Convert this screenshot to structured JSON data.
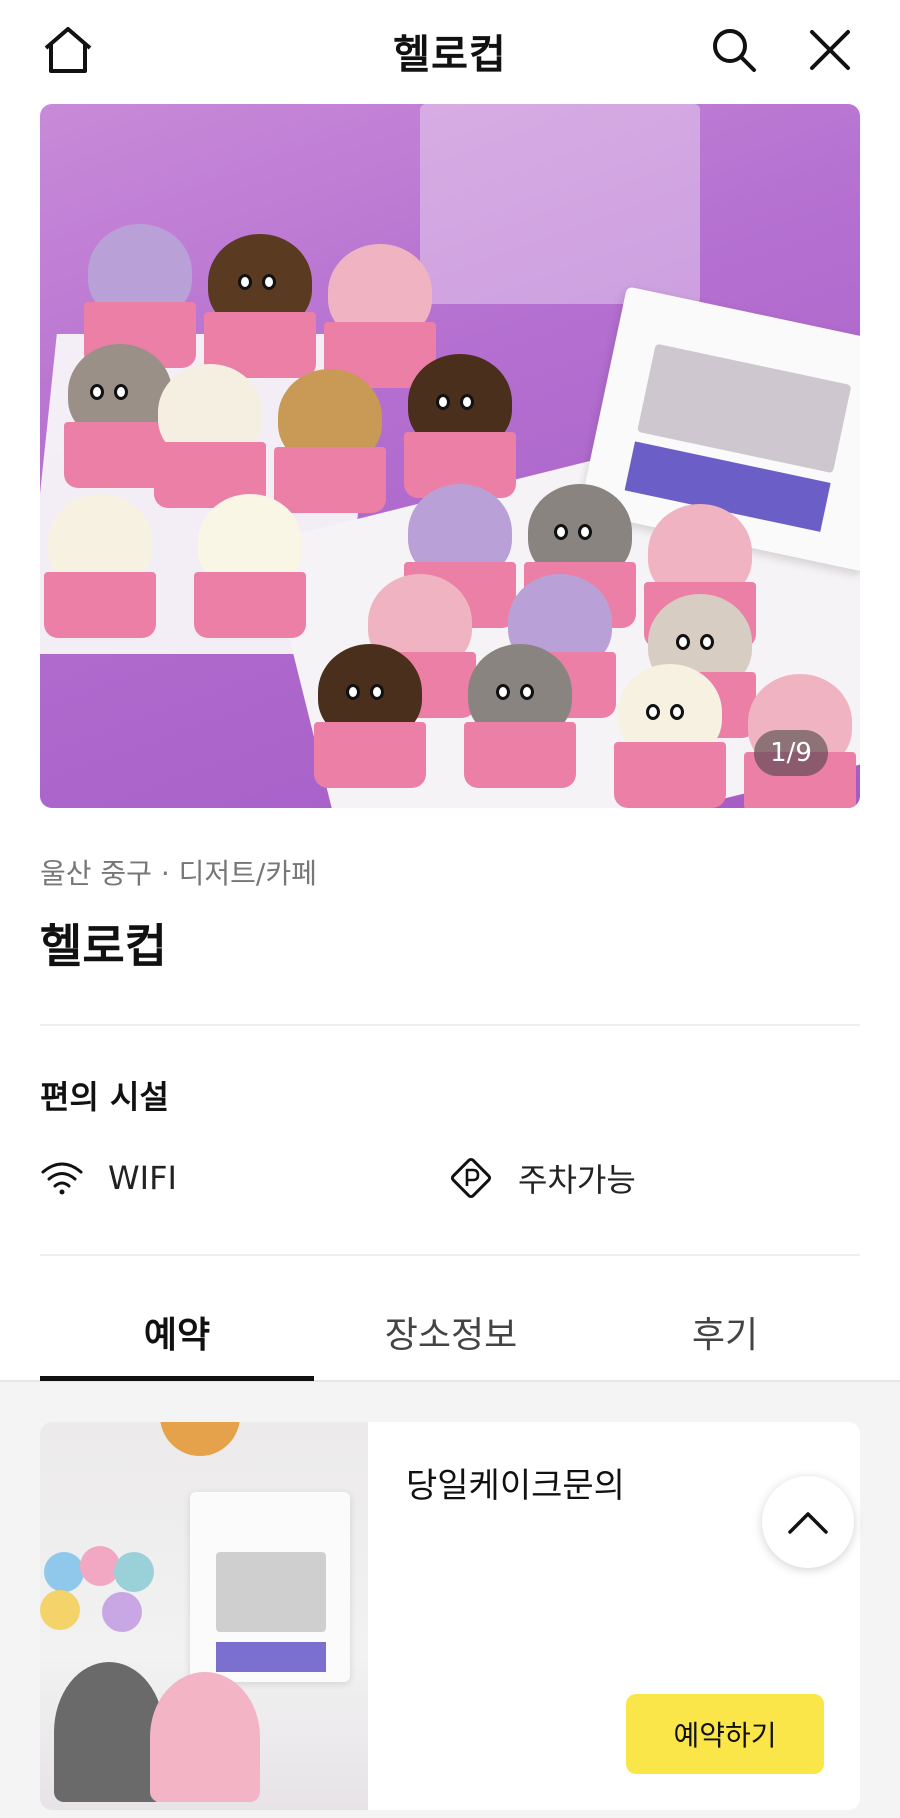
{
  "header": {
    "title": "헬로컵"
  },
  "hero": {
    "counter": "1/9"
  },
  "place": {
    "meta": "울산 중구 · 디저트/카페",
    "name": "헬로컵"
  },
  "amenities": {
    "title": "편의 시설",
    "items": [
      {
        "label": "WIFI",
        "icon": "wifi-icon"
      },
      {
        "label": "주차가능",
        "icon": "parking-icon"
      }
    ]
  },
  "tabs": [
    {
      "label": "예약",
      "active": true
    },
    {
      "label": "장소정보",
      "active": false
    },
    {
      "label": "후기",
      "active": false
    }
  ],
  "reservation_card": {
    "title": "당일케이크문의",
    "button": "예약하기"
  },
  "colors": {
    "accent_yellow": "#fbe64a",
    "text": "#111111",
    "muted": "#777777"
  }
}
